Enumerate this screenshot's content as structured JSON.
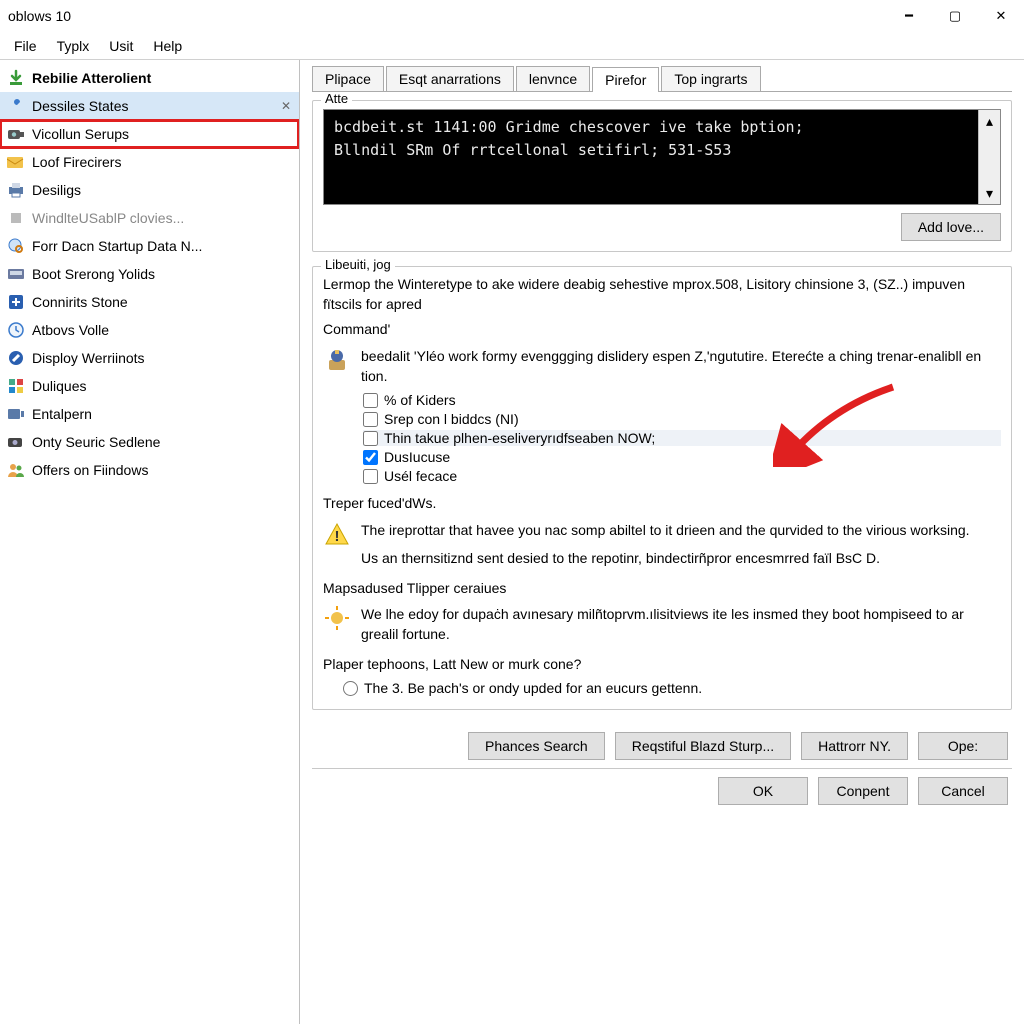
{
  "window": {
    "title": "oblows 10"
  },
  "menu": {
    "file": "File",
    "typlx": "Typlx",
    "usit": "Usit",
    "help": "Help"
  },
  "sidebar": {
    "items": [
      {
        "label": "Rebilie Atterolient",
        "bold": true
      },
      {
        "label": "Dessiles States",
        "sel": true
      },
      {
        "label": "Vicollun Serups",
        "redbox": true
      },
      {
        "label": "Loof Firecirers"
      },
      {
        "label": "Desiligs"
      },
      {
        "label": "WindlteUSablP clovies...",
        "disabled": true
      },
      {
        "label": "Forr Dacn Startup Data N..."
      },
      {
        "label": "Boot Srerong Yolids"
      },
      {
        "label": "Connirits Stone"
      },
      {
        "label": "Atbovs Volle"
      },
      {
        "label": "Disploy Werriinots"
      },
      {
        "label": "Duliques"
      },
      {
        "label": "Entalpern"
      },
      {
        "label": "Onty Seuric Sedlene"
      },
      {
        "label": "Offers on Fiindows"
      }
    ]
  },
  "tabs": [
    "Plipace",
    "Esqt anarrations",
    "lenvnce",
    "Pirefor",
    "Top ingrarts"
  ],
  "active_tab": 3,
  "atte": {
    "legend": "Atte",
    "terminal": "bcdbeit.st 1141:00 Gridme chescover ive take bption;\nBllndil SRm Of rrtcellonal setifirl; 531-S53",
    "add_btn": "Add love..."
  },
  "libeuiti": {
    "legend": "Libeuiti, jog",
    "intro": "Lermop the Winteretype to ake widere deabig sehestive mprox.508, Lisitory chinsione 3, (SZ..) impuven fïtscils for apred",
    "command_label": "Command'",
    "command_desc": "beedalit 'Yléo work formy evenggging dislidery espen Z,'ngututire. Eterećte a ching trenar-enalibll en tion.",
    "opts": {
      "kiders": "% of Kiders",
      "srep": "Srep con l biddcs (NI)",
      "thin": "Thin takue plhen-eseliveryrıdfseaben NOW;",
      "dusl": "DusIucuse",
      "usel": "Usél fecace"
    },
    "treper_label": "Treper fuced'dWs.",
    "warn1": "The ireprottar that havee you nac somp abiltel to it drieen and the qurvided to the virious worksing.",
    "warn2": "Us an thernsitiznd sent desied to the repotinr, bindectirñpror encesmrred faïl BsC D.",
    "mapsa_label": "Mapsadused Tlipper ceraiues",
    "mapsa_text": "We lhe edoy for dupaċh avınesary milñtoprvm.ılisitviews ite les insmed they boot hompiseed to ar grealil fortune.",
    "plaper_label": "Plaper tephoons, Latt New or murk cone?",
    "radio": "The 3. Be pach's or ondy upded for an eucurs gettenn."
  },
  "inner_buttons": [
    "Phances Search",
    "Reqstiful Blazd Sturp...",
    "Hattrorr NY.",
    "Ope:"
  ],
  "footer_buttons": [
    "OK",
    "Conpent",
    "Cancel"
  ]
}
